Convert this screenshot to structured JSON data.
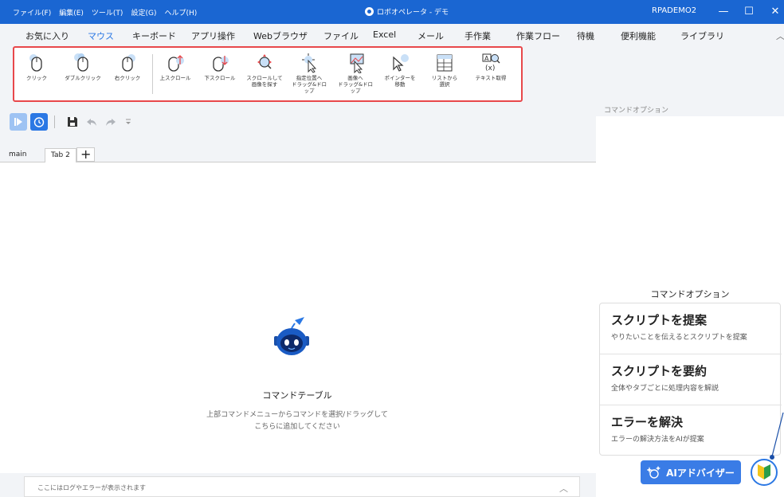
{
  "titlebar": {
    "menus": [
      "ファイル(F)",
      "編集(E)",
      "ツール(T)",
      "設定(G)",
      "ヘルプ(H)"
    ],
    "app_title": "ロボオペレータ - デモ",
    "user": "RPADEMO2",
    "minimize": "—",
    "maximize": "☐",
    "close": "✕"
  },
  "tabs": [
    "お気に入り",
    "マウス",
    "キーボード",
    "アプリ操作",
    "Webブラウザ",
    "ファイル",
    "Excel",
    "メール",
    "手作業",
    "作業フロー",
    "待機",
    "便利機能",
    "ライブラリ"
  ],
  "active_tab": "マウス",
  "ribbon": {
    "buttons": [
      {
        "label": "クリック",
        "icon": "mouse-click-icon"
      },
      {
        "label": "ダブルクリック",
        "icon": "mouse-double-click-icon"
      },
      {
        "label": "右クリック",
        "icon": "mouse-right-click-icon"
      },
      {
        "label": "上スクロール",
        "icon": "scroll-up-icon"
      },
      {
        "label": "下スクロール",
        "icon": "scroll-down-icon"
      },
      {
        "label": "スクロールして\n画像を探す",
        "icon": "scroll-find-image-icon"
      },
      {
        "label": "指定位置へ\nドラッグ&ドロップ",
        "icon": "drag-to-position-icon"
      },
      {
        "label": "画像へ\nドラッグ&ドロップ",
        "icon": "drag-to-image-icon"
      },
      {
        "label": "ポインターを\n移動",
        "icon": "move-pointer-icon"
      },
      {
        "label": "リストから\n選択",
        "icon": "select-from-list-icon"
      },
      {
        "label": "テキスト取得",
        "icon": "get-text-icon"
      }
    ]
  },
  "right_panel": {
    "header": "コマンドオプション",
    "center_title": "コマンドオプション",
    "ai_items": [
      {
        "title": "スクリプトを提案",
        "desc": "やりたいことを伝えるとスクリプトを提案"
      },
      {
        "title": "スクリプトを要約",
        "desc": "全体やタブごとに処理内容を解説"
      },
      {
        "title": "エラーを解決",
        "desc": "エラーの解決方法をAIが提案"
      }
    ],
    "ai_button": "AIアドバイザー"
  },
  "editor": {
    "tabs": [
      "main",
      "Tab 2"
    ],
    "add_tab": "+",
    "canvas_title": "コマンドテーブル",
    "canvas_hint_1": "上部コマンドメニューからコマンドを選択/ドラッグして",
    "canvas_hint_2": "こちらに追加してください",
    "log_placeholder": "ここにはログやエラーが表示されます",
    "log_chevron": "︿"
  },
  "colors": {
    "accent": "#1a66d2",
    "highlight_border": "#e8484b",
    "ai_button": "#3a7ce6"
  }
}
